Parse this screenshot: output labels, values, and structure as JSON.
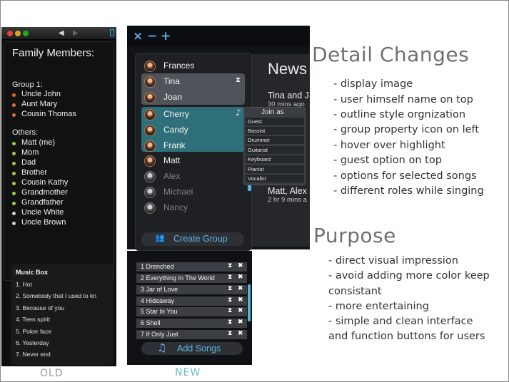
{
  "old_app": {
    "title": "Family Members:",
    "group1_label": "Group 1:",
    "group1": [
      "Uncle John",
      "Aunt Mary",
      "Cousin Thomas"
    ],
    "others_label": "Others:",
    "others": [
      "Matt (me)",
      "Mom",
      "Dad",
      "Brother",
      "Cousin Kathy",
      "Grandmother",
      "Grandfather",
      "Uncle White",
      "Uncle Brown"
    ],
    "music_box": {
      "title": "Music Box",
      "songs": [
        "1. Hot",
        "2. Somebody that I used to kn",
        "3. Because of you",
        "4. Teen spirit",
        "5. Poker face",
        "6. Yesterday",
        "7. Never end"
      ]
    },
    "caption": "OLD"
  },
  "new_app": {
    "toolbar": {
      "close": "×",
      "minus": "−",
      "plus": "+"
    },
    "members": [
      {
        "name": "Frances"
      },
      {
        "name": "Tina"
      },
      {
        "name": "Joan"
      },
      {
        "name": "Cherry"
      },
      {
        "name": "Candy"
      },
      {
        "name": "Frank"
      },
      {
        "name": "Matt"
      },
      {
        "name": "Alex"
      },
      {
        "name": "Michael"
      },
      {
        "name": "Nancy"
      }
    ],
    "join_as": {
      "title": "Join as",
      "roles": [
        "Guest",
        "Bassist",
        "Drummer",
        "Guitarist",
        "Keyboard",
        "Pianist",
        "Vocalist"
      ]
    },
    "news": {
      "title": "News",
      "item1_name": "Tina and J",
      "item1_time": "30 mins ago",
      "item2_name": "Matt, Alex",
      "item2_time": "2 hr 9 mins a"
    },
    "create_group": "Create Group",
    "songs": [
      "1 Drenched",
      "2 Everything In The World",
      "3 Jar of Love",
      "4 Hideaway",
      "5 Star In You",
      "6 Shell",
      "7 If Only Just"
    ],
    "add_songs": "Add Songs",
    "caption": "NEW"
  },
  "detail_changes": {
    "heading": "Detail Changes",
    "items": [
      "- display image",
      "- user himself name on top",
      "- outline style orgnization",
      "- group property icon on left",
      "- hover over highlight",
      "- guest option on top",
      "- options for selected songs",
      "- different roles while singing"
    ]
  },
  "purpose": {
    "heading": "Purpose",
    "lines": [
      "- direct visual impression",
      "- avoid adding more color keep",
      "consistant",
      "- more entertaining",
      "- simple and clean interface",
      "and function buttons for users"
    ]
  }
}
